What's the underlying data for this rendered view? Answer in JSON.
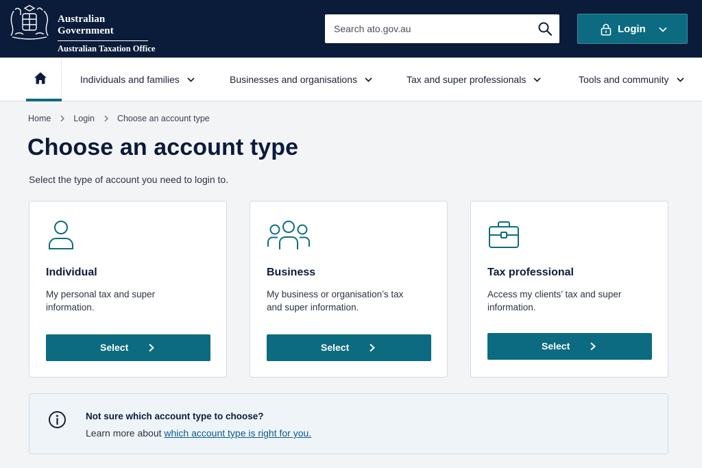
{
  "header": {
    "gov_line1": "Australian Government",
    "gov_line2": "Australian Taxation Office",
    "search_placeholder": "Search ato.gov.au",
    "login_label": "Login"
  },
  "nav": {
    "items": [
      {
        "label": "Individuals and families"
      },
      {
        "label": "Businesses and organisations"
      },
      {
        "label": "Tax and super professionals"
      },
      {
        "label": "Tools and community"
      }
    ]
  },
  "breadcrumb": {
    "items": [
      "Home",
      "Login",
      "Choose an account type"
    ]
  },
  "main": {
    "title": "Choose an account type",
    "intro": "Select the type of account you need to login to.",
    "cards": [
      {
        "title": "Individual",
        "desc": "My personal tax and super information.",
        "button": "Select",
        "icon": "person-icon"
      },
      {
        "title": "Business",
        "desc": "My business or organisation’s tax and super information.",
        "button": "Select",
        "icon": "group-icon"
      },
      {
        "title": "Tax professional",
        "desc": "Access my clients’ tax and super information.",
        "button": "Select",
        "icon": "briefcase-icon"
      }
    ]
  },
  "info": {
    "question": "Not sure which account type to choose?",
    "prefix": "Learn more about ",
    "link": "which account type is right for you."
  },
  "colors": {
    "header_bg": "#0b1b3a",
    "accent": "#0c6b80",
    "link": "#0a5c8a"
  }
}
